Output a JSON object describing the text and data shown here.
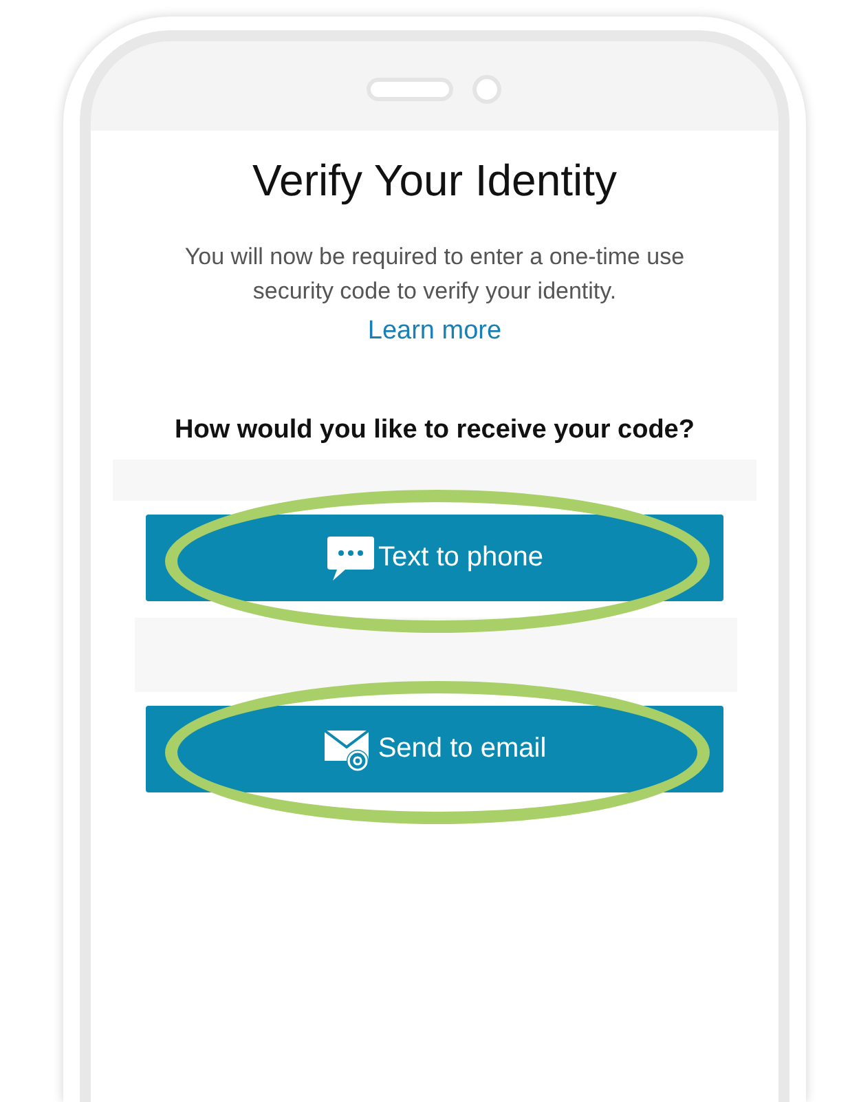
{
  "screen": {
    "title": "Verify Your Identity",
    "description": "You will now be required to enter a one-time use security code to verify your identity.",
    "link": "Learn more",
    "question": "How would you like to receive your code?",
    "options": [
      {
        "kind": "phone",
        "label": "Text to phone",
        "highlighted": true
      },
      {
        "kind": "email",
        "label": "Send to email",
        "highlighted": true
      }
    ]
  }
}
